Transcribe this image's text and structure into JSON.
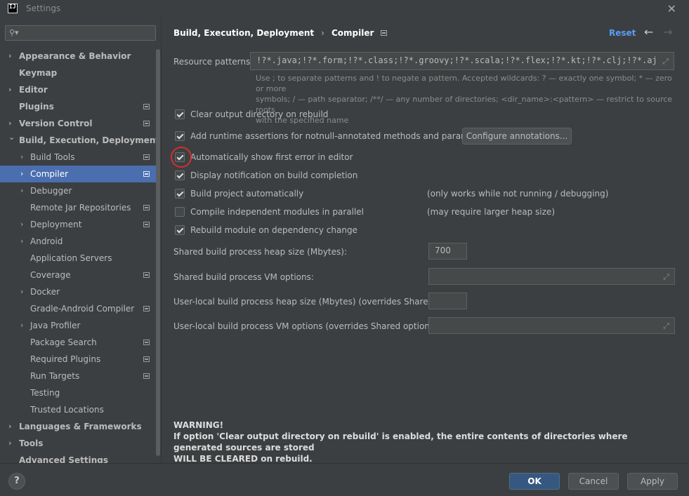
{
  "window": {
    "title": "Settings",
    "app_icon_text": "IJ",
    "close_glyph": "✕"
  },
  "sidebar": {
    "search_placeholder": "",
    "items": [
      {
        "label": "Appearance & Behavior",
        "bold": true,
        "chevron": "right",
        "indent": 0,
        "icon": false,
        "selected": false
      },
      {
        "label": "Keymap",
        "bold": true,
        "chevron": "none",
        "indent": 0,
        "icon": false,
        "selected": false
      },
      {
        "label": "Editor",
        "bold": true,
        "chevron": "right",
        "indent": 0,
        "icon": false,
        "selected": false
      },
      {
        "label": "Plugins",
        "bold": true,
        "chevron": "none",
        "indent": 0,
        "icon": true,
        "selected": false
      },
      {
        "label": "Version Control",
        "bold": true,
        "chevron": "right",
        "indent": 0,
        "icon": true,
        "selected": false
      },
      {
        "label": "Build, Execution, Deployment",
        "bold": true,
        "chevron": "down",
        "indent": 0,
        "icon": false,
        "selected": false
      },
      {
        "label": "Build Tools",
        "bold": false,
        "chevron": "right",
        "indent": 1,
        "icon": true,
        "selected": false
      },
      {
        "label": "Compiler",
        "bold": false,
        "chevron": "right",
        "indent": 1,
        "icon": true,
        "selected": true
      },
      {
        "label": "Debugger",
        "bold": false,
        "chevron": "right",
        "indent": 1,
        "icon": false,
        "selected": false
      },
      {
        "label": "Remote Jar Repositories",
        "bold": false,
        "chevron": "none",
        "indent": 1,
        "icon": true,
        "selected": false
      },
      {
        "label": "Deployment",
        "bold": false,
        "chevron": "right",
        "indent": 1,
        "icon": true,
        "selected": false
      },
      {
        "label": "Android",
        "bold": false,
        "chevron": "right",
        "indent": 1,
        "icon": false,
        "selected": false
      },
      {
        "label": "Application Servers",
        "bold": false,
        "chevron": "none",
        "indent": 1,
        "icon": false,
        "selected": false
      },
      {
        "label": "Coverage",
        "bold": false,
        "chevron": "none",
        "indent": 1,
        "icon": true,
        "selected": false
      },
      {
        "label": "Docker",
        "bold": false,
        "chevron": "right",
        "indent": 1,
        "icon": false,
        "selected": false
      },
      {
        "label": "Gradle-Android Compiler",
        "bold": false,
        "chevron": "none",
        "indent": 1,
        "icon": true,
        "selected": false
      },
      {
        "label": "Java Profiler",
        "bold": false,
        "chevron": "right",
        "indent": 1,
        "icon": false,
        "selected": false
      },
      {
        "label": "Package Search",
        "bold": false,
        "chevron": "none",
        "indent": 1,
        "icon": true,
        "selected": false
      },
      {
        "label": "Required Plugins",
        "bold": false,
        "chevron": "none",
        "indent": 1,
        "icon": true,
        "selected": false
      },
      {
        "label": "Run Targets",
        "bold": false,
        "chevron": "none",
        "indent": 1,
        "icon": true,
        "selected": false
      },
      {
        "label": "Testing",
        "bold": false,
        "chevron": "none",
        "indent": 1,
        "icon": false,
        "selected": false
      },
      {
        "label": "Trusted Locations",
        "bold": false,
        "chevron": "none",
        "indent": 1,
        "icon": false,
        "selected": false
      },
      {
        "label": "Languages & Frameworks",
        "bold": true,
        "chevron": "right",
        "indent": 0,
        "icon": false,
        "selected": false
      },
      {
        "label": "Tools",
        "bold": true,
        "chevron": "right",
        "indent": 0,
        "icon": false,
        "selected": false
      },
      {
        "label": "Advanced Settings",
        "bold": true,
        "chevron": "none",
        "indent": 0,
        "icon": false,
        "selected": false
      }
    ]
  },
  "header": {
    "breadcrumb_parent": "Build, Execution, Deployment",
    "breadcrumb_sep": "›",
    "breadcrumb_current": "Compiler",
    "reset_label": "Reset",
    "back_glyph": "←",
    "forward_glyph": "→"
  },
  "resource_patterns": {
    "label": "Resource patterns:",
    "value": "!?*.java;!?*.form;!?*.class;!?*.groovy;!?*.scala;!?*.flex;!?*.kt;!?*.clj;!?*.aj",
    "hint_line1": "Use ; to separate patterns and ! to negate a pattern. Accepted wildcards: ? — exactly one symbol; * — zero or more",
    "hint_line2": "symbols; / — path separator; /**/ — any number of directories; <dir_name>:<pattern> — restrict to source roots",
    "hint_line3": "with the specified name"
  },
  "options": {
    "clear_output": {
      "label": "Clear output directory on rebuild",
      "checked": true
    },
    "runtime_assertions": {
      "label": "Add runtime assertions for notnull-annotated methods and parameters",
      "checked": true
    },
    "configure_annotations_label": "Configure annotations...",
    "show_first_error": {
      "label": "Automatically show first error in editor",
      "checked": true
    },
    "display_notification": {
      "label": "Display notification on build completion",
      "checked": true
    },
    "build_automatically": {
      "label": "Build project automatically",
      "checked": true,
      "note": "(only works while not running / debugging)"
    },
    "compile_parallel": {
      "label": "Compile independent modules in parallel",
      "checked": false,
      "note": "(may require larger heap size)"
    },
    "rebuild_on_change": {
      "label": "Rebuild module on dependency change",
      "checked": true
    }
  },
  "fields": {
    "shared_heap": {
      "label": "Shared build process heap size (Mbytes):",
      "value": "700"
    },
    "shared_vm": {
      "label": "Shared build process VM options:",
      "value": ""
    },
    "local_heap": {
      "label": "User-local build process heap size (Mbytes) (overrides Shared size):",
      "value": ""
    },
    "local_vm": {
      "label": "User-local build process VM options (overrides Shared options):",
      "value": ""
    }
  },
  "warning": {
    "title": "WARNING!",
    "line1": "If option 'Clear output directory on rebuild' is enabled, the entire contents of directories where generated sources are stored",
    "line2": "WILL BE CLEARED on rebuild."
  },
  "footer": {
    "help_glyph": "?",
    "ok_label": "OK",
    "cancel_label": "Cancel",
    "apply_label": "Apply"
  },
  "colors": {
    "accent": "#4b6eaf",
    "link": "#589df6",
    "annotation_circle": "#d32f2f",
    "background": "#3c3f41"
  }
}
